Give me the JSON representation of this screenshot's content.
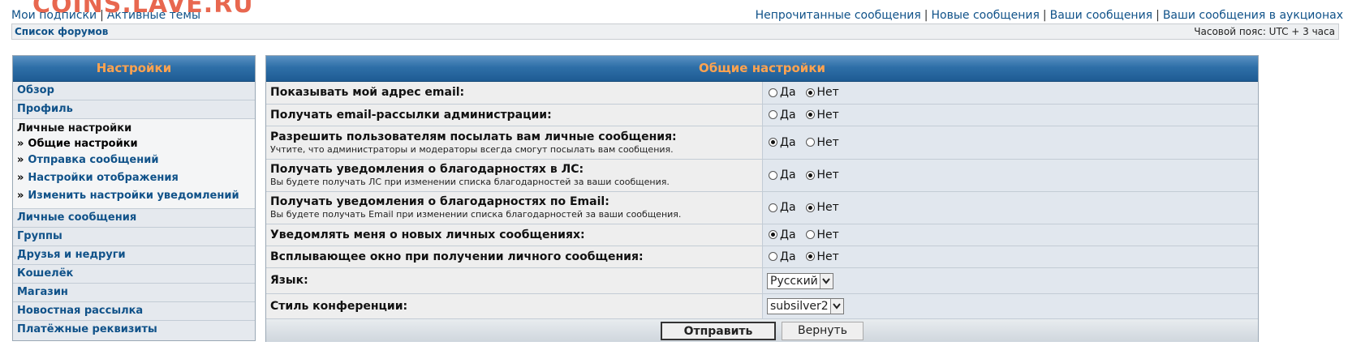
{
  "watermark": "COINS.LAVE.RU",
  "top_left_links": [
    "Мои подписки",
    "Активные темы"
  ],
  "top_right_links": [
    "Непрочитанные сообщения",
    "Новые сообщения",
    "Ваши сообщения",
    "Ваши сообщения в аукционах"
  ],
  "breadcrumb": "Список форумов",
  "timezone": "Часовой пояс: UTC + 3 часа",
  "sidebar": {
    "title": "Настройки",
    "items_top": [
      "Обзор",
      "Профиль"
    ],
    "group_title": "Личные настройки",
    "group_items": [
      {
        "label": "Общие настройки",
        "active": true
      },
      {
        "label": "Отправка сообщений",
        "active": false
      },
      {
        "label": "Настройки отображения",
        "active": false
      },
      {
        "label": "Изменить настройки уведомлений",
        "active": false
      }
    ],
    "items_bottom": [
      "Личные сообщения",
      "Группы",
      "Друзья и недруги",
      "Кошелёк",
      "Магазин",
      "Новостная рассылка",
      "Платёжные реквизиты"
    ],
    "bullet": "»"
  },
  "main": {
    "title": "Общие настройки",
    "yes_label": "Да",
    "no_label": "Нет",
    "rows": [
      {
        "label": "Показывать мой адрес email:",
        "hint": "",
        "value": "no"
      },
      {
        "label": "Получать email-рассылки администрации:",
        "hint": "",
        "value": "no"
      },
      {
        "label": "Разрешить пользователям посылать вам личные сообщения:",
        "hint": "Учтите, что администраторы и модераторы всегда смогут посылать вам сообщения.",
        "value": "yes"
      },
      {
        "label": "Получать уведомления о благодарностях в ЛС:",
        "hint": "Вы будете получать ЛС при изменении списка благодарностей за ваши сообщения.",
        "value": "no"
      },
      {
        "label": "Получать уведомления о благодарностях по Email:",
        "hint": "Вы будете получать Email при изменении списка благодарностей за ваши сообщения.",
        "value": "no"
      },
      {
        "label": "Уведомлять меня о новых личных сообщениях:",
        "hint": "",
        "value": "yes"
      },
      {
        "label": "Всплывающее окно при получении личного сообщения:",
        "hint": "",
        "value": "no"
      }
    ],
    "language": {
      "label": "Язык:",
      "value": "Русский"
    },
    "style": {
      "label": "Стиль конференции:",
      "value": "subsilver2"
    },
    "submit_label": "Отправить",
    "reset_label": "Вернуть"
  },
  "colors": {
    "accent_header": "#2e6fa8",
    "header_text": "#ffa34f",
    "link": "#105289",
    "watermark": "#e8674f"
  }
}
